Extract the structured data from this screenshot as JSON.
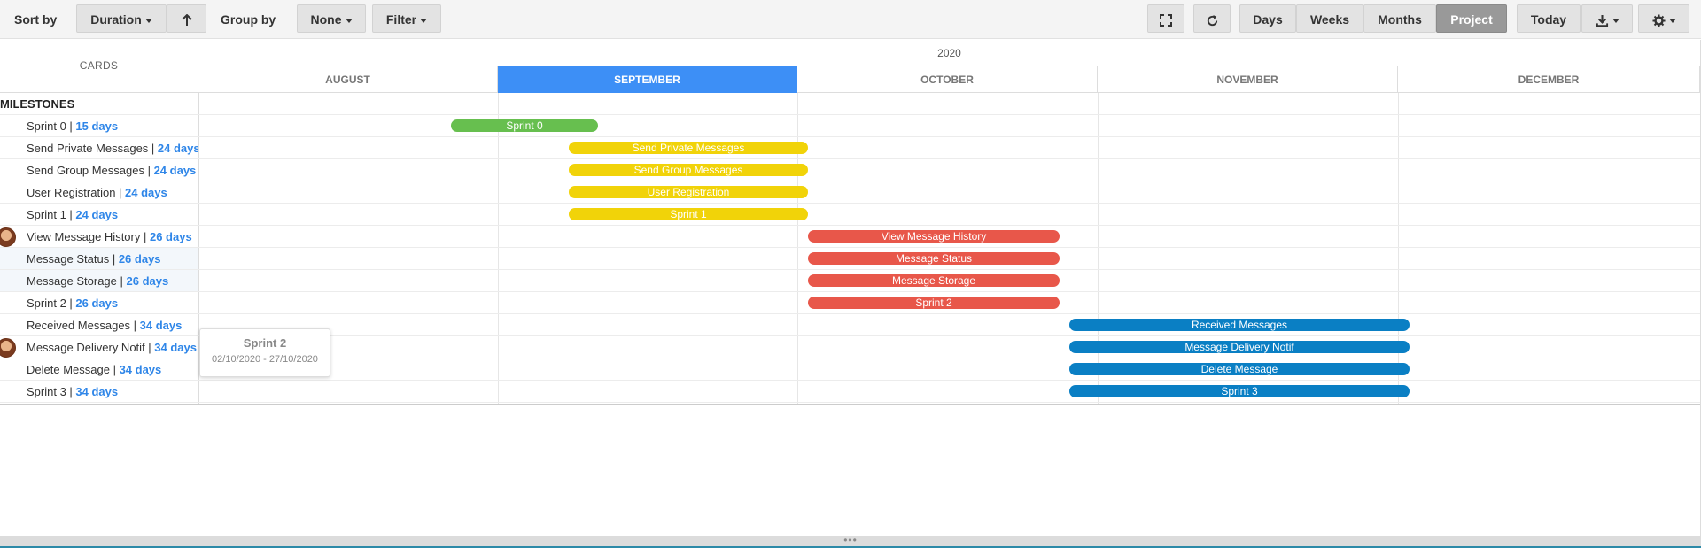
{
  "toolbar": {
    "sort_label": "Sort by",
    "sort_value": "Duration",
    "sort_dir_icon": "arrow-up-icon",
    "group_label": "Group by",
    "group_value": "None",
    "filter_label": "Filter",
    "fullscreen_icon": "fullscreen-icon",
    "refresh_icon": "refresh-icon",
    "views": [
      "Days",
      "Weeks",
      "Months",
      "Project"
    ],
    "active_view": "Project",
    "today_label": "Today",
    "export_icon": "download-icon",
    "settings_icon": "gear-icon"
  },
  "timeline": {
    "cards_header": "CARDS",
    "year": "2020",
    "months": [
      "AUGUST",
      "SEPTEMBER",
      "OCTOBER",
      "NOVEMBER",
      "DECEMBER"
    ],
    "active_month": "SEPTEMBER"
  },
  "group": {
    "label": "MILESTONES"
  },
  "colors": {
    "green": "#67bf4f",
    "yellow": "#f1d309",
    "red": "#e8574a",
    "blue": "#0a7fc4",
    "accent": "#3d8ff6"
  },
  "rows": [
    {
      "name": "Sprint 0",
      "duration": "15 days",
      "bar_label": "Sprint 0",
      "color": "#67bf4f",
      "avatar": false,
      "tinted": false
    },
    {
      "name": "Send Private Messages",
      "duration": "24 days",
      "bar_label": "Send Private Messages",
      "color": "#f1d309",
      "avatar": false,
      "tinted": false
    },
    {
      "name": "Send Group Messages",
      "duration": "24 days",
      "bar_label": "Send Group Messages",
      "color": "#f1d309",
      "avatar": false,
      "tinted": false
    },
    {
      "name": "User Registration",
      "duration": "24 days",
      "bar_label": "User Registration",
      "color": "#f1d309",
      "avatar": false,
      "tinted": false
    },
    {
      "name": "Sprint 1",
      "duration": "24 days",
      "bar_label": "Sprint 1",
      "color": "#f1d309",
      "avatar": false,
      "tinted": false
    },
    {
      "name": "View Message History",
      "duration": "26 days",
      "bar_label": "View Message History",
      "color": "#e8574a",
      "avatar": true,
      "tinted": false
    },
    {
      "name": "Message Status",
      "duration": "26 days",
      "bar_label": "Message Status",
      "color": "#e8574a",
      "avatar": false,
      "tinted": true
    },
    {
      "name": "Message Storage",
      "duration": "26 days",
      "bar_label": "Message Storage",
      "color": "#e8574a",
      "avatar": false,
      "tinted": true
    },
    {
      "name": "Sprint 2",
      "duration": "26 days",
      "bar_label": "Sprint 2",
      "color": "#e8574a",
      "avatar": false,
      "tinted": false
    },
    {
      "name": "Received Messages",
      "duration": "34 days",
      "bar_label": "Received Messages",
      "color": "#0a7fc4",
      "avatar": false,
      "tinted": false
    },
    {
      "name": "Message Delivery Notif",
      "duration": "34 days",
      "bar_label": "Message Delivery Notif",
      "color": "#0a7fc4",
      "avatar": true,
      "tinted": false
    },
    {
      "name": "Delete Message",
      "duration": "34 days",
      "bar_label": "Delete Message",
      "color": "#0a7fc4",
      "avatar": false,
      "tinted": false
    },
    {
      "name": "Sprint 3",
      "duration": "34 days",
      "bar_label": "Sprint 3",
      "color": "#0a7fc4",
      "avatar": false,
      "tinted": false
    }
  ],
  "tooltip": {
    "title": "Sprint 2",
    "dates": "02/10/2020 - 27/10/2020"
  },
  "splitter": {
    "handle": "•••"
  }
}
